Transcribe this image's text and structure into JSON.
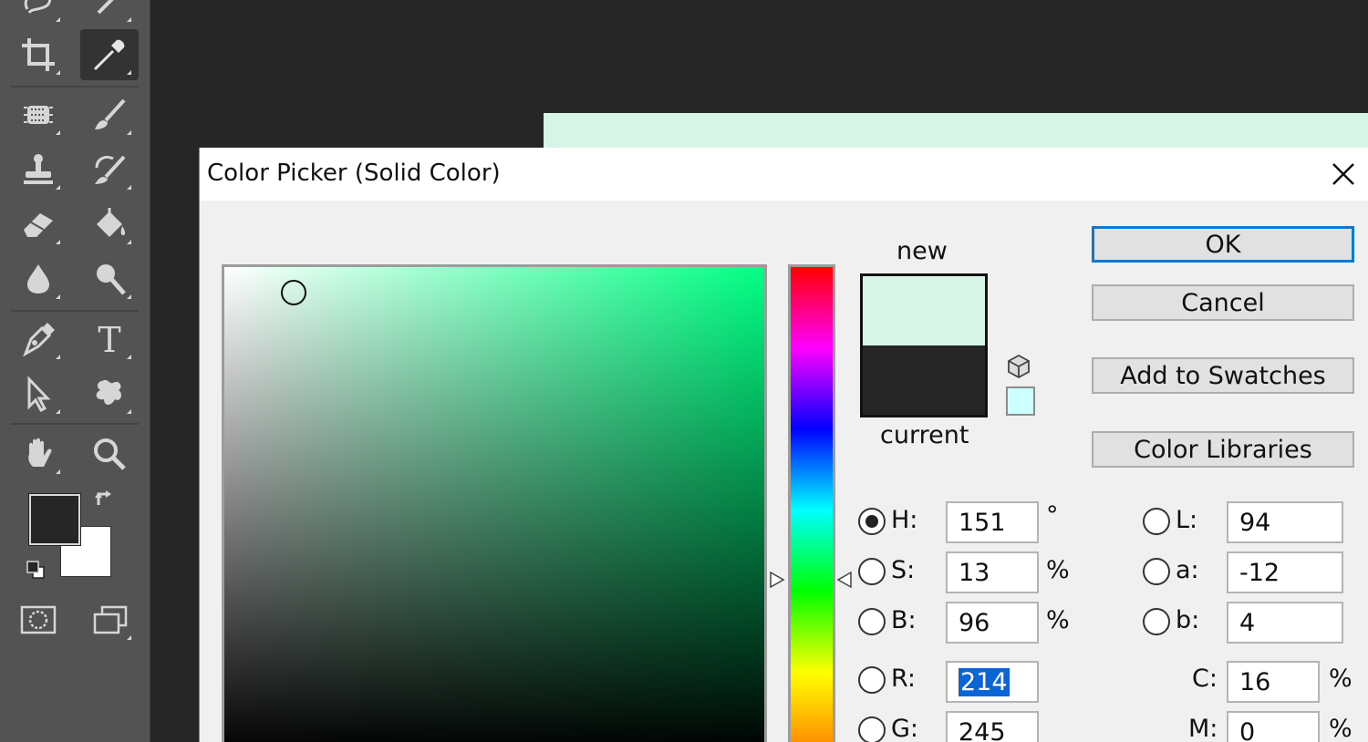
{
  "dialog": {
    "title": "Color Picker (Solid Color)",
    "close_label": "✕"
  },
  "preview": {
    "new_label": "new",
    "current_label": "current",
    "new_color": "#d6f5e6",
    "current_color": "#262626",
    "websafe_color": "#ccffff"
  },
  "buttons": {
    "ok": "OK",
    "cancel": "Cancel",
    "add_to_swatches": "Add to Swatches",
    "color_libraries": "Color Libraries"
  },
  "fields": {
    "H": {
      "label": "H:",
      "value": "151",
      "unit": "°",
      "checked": true
    },
    "S": {
      "label": "S:",
      "value": "13",
      "unit": "%"
    },
    "B": {
      "label": "B:",
      "value": "96",
      "unit": "%"
    },
    "R": {
      "label": "R:",
      "value": "214"
    },
    "G": {
      "label": "G:",
      "value": "245"
    },
    "L": {
      "label": "L:",
      "value": "94"
    },
    "a": {
      "label": "a:",
      "value": "-12"
    },
    "b": {
      "label": "b:",
      "value": "4"
    },
    "C": {
      "label": "C:",
      "value": "16",
      "unit": "%"
    },
    "M": {
      "label": "M:",
      "value": "0",
      "unit": "%"
    }
  },
  "toolbar": {
    "foreground_color": "#262626",
    "background_color": "#ffffff",
    "tools": [
      "lasso-icon",
      "magic-wand-icon",
      "crop-icon",
      "eyedropper-icon",
      "spot-healing-icon",
      "brush-icon",
      "clone-stamp-icon",
      "history-brush-icon",
      "eraser-icon",
      "paint-bucket-icon",
      "blur-icon",
      "dodge-icon",
      "pen-icon",
      "type-icon",
      "path-selection-icon",
      "custom-shape-icon",
      "hand-icon",
      "zoom-icon",
      "quick-mask-icon",
      "screen-mode-icon"
    ],
    "type_tool_glyph": "T"
  }
}
